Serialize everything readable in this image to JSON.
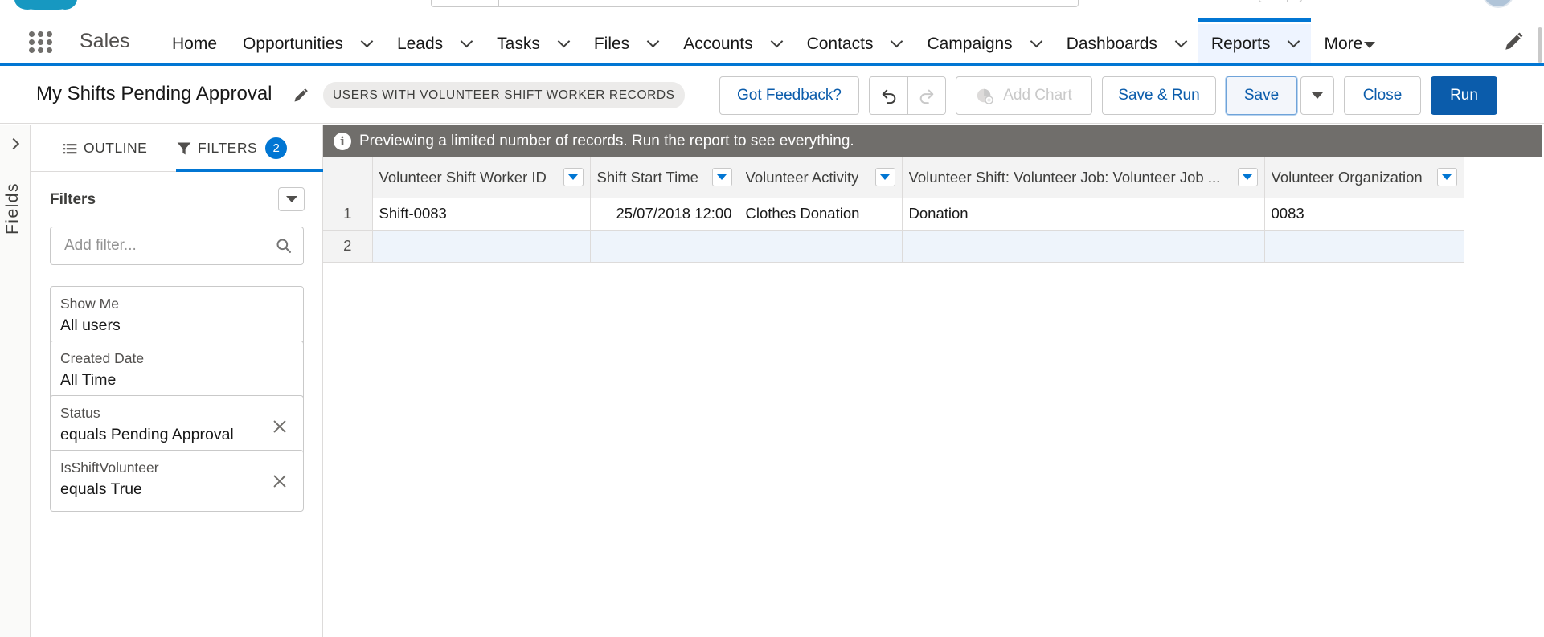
{
  "app": {
    "name": "Sales"
  },
  "nav": {
    "items": [
      {
        "label": "Home",
        "chevron": false
      },
      {
        "label": "Opportunities",
        "chevron": true
      },
      {
        "label": "Leads",
        "chevron": true
      },
      {
        "label": "Tasks",
        "chevron": true
      },
      {
        "label": "Files",
        "chevron": true
      },
      {
        "label": "Accounts",
        "chevron": true
      },
      {
        "label": "Contacts",
        "chevron": true
      },
      {
        "label": "Campaigns",
        "chevron": true
      },
      {
        "label": "Dashboards",
        "chevron": true
      },
      {
        "label": "Reports",
        "chevron": true,
        "active": true
      },
      {
        "label": "More",
        "chevron": false,
        "triangle": true
      }
    ]
  },
  "report": {
    "title": "My Shifts Pending Approval",
    "report_type": "USERS WITH VOLUNTEER SHIFT WORKER RECORDS"
  },
  "toolbar": {
    "feedback_label": "Got Feedback?",
    "add_chart_label": "Add Chart",
    "save_run_label": "Save & Run",
    "save_label": "Save",
    "close_label": "Close",
    "run_label": "Run"
  },
  "sidebar": {
    "fields_label": "Fields"
  },
  "panel": {
    "outline_tab": "OUTLINE",
    "filters_tab": "FILTERS",
    "filters_count": "2",
    "heading": "Filters",
    "add_filter_placeholder": "Add filter...",
    "filters": [
      {
        "label": "Show Me",
        "value": "All users",
        "removable": false
      },
      {
        "label": "Created Date",
        "value": "All Time",
        "removable": false
      },
      {
        "label": "Status",
        "value": "equals Pending Approval",
        "removable": true
      },
      {
        "label": "IsShiftVolunteer",
        "value": "equals True",
        "removable": true
      }
    ]
  },
  "preview": {
    "banner": "Previewing a limited number of records. Run the report to see everything.",
    "columns": [
      "Volunteer Shift Worker ID",
      "Shift Start Time",
      "Volunteer Activity",
      "Volunteer Shift: Volunteer Job: Volunteer Job ...",
      "Volunteer Organization"
    ],
    "rows": [
      {
        "num": "1",
        "cells": [
          "Shift-0083",
          "25/07/2018 12:00",
          "Clothes Donation",
          "Donation",
          "0083"
        ]
      },
      {
        "num": "2",
        "cells": [
          "",
          "",
          "",
          "",
          ""
        ]
      }
    ]
  },
  "colors": {
    "brand": "#0176d3",
    "brand_dark": "#0b5cab",
    "banner_bg": "#706e6b"
  }
}
